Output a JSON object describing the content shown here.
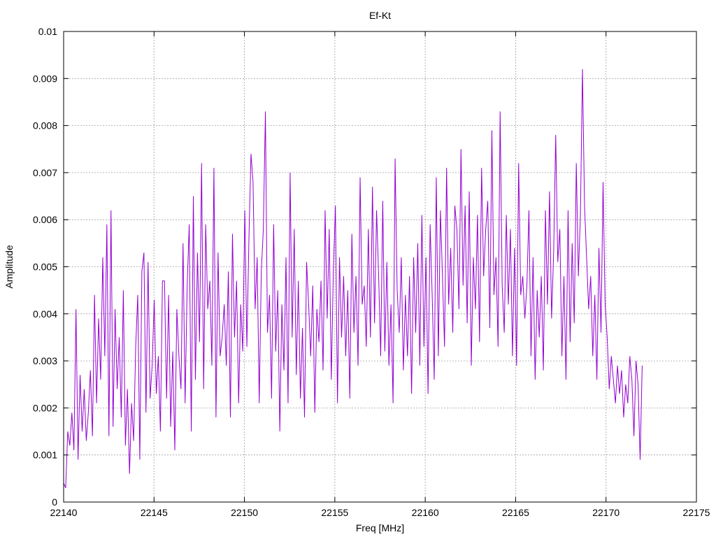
{
  "chart_data": {
    "type": "line",
    "title": "Ef-Kt",
    "xlabel": "Freq [MHz]",
    "ylabel": "Amplitude",
    "xlim": [
      22140,
      22175
    ],
    "ylim": [
      0,
      0.01
    ],
    "x_ticks": [
      "22140",
      "22145",
      "22150",
      "22155",
      "22160",
      "22165",
      "22170",
      "22175"
    ],
    "y_ticks": [
      "0",
      "0.001",
      "0.002",
      "0.003",
      "0.004",
      "0.005",
      "0.006",
      "0.007",
      "0.008",
      "0.009",
      "0.01"
    ],
    "grid": true,
    "series_color": "#9400d3",
    "x_start": 22140,
    "x_end": 22172,
    "series": [
      {
        "values": [
          0.0004,
          0.0003,
          0.0015,
          0.0012,
          0.0019,
          0.0011,
          0.0041,
          0.0009,
          0.0027,
          0.0015,
          0.0024,
          0.0013,
          0.0019,
          0.0028,
          0.0014,
          0.0044,
          0.0021,
          0.0039,
          0.0026,
          0.0052,
          0.0031,
          0.0059,
          0.0014,
          0.0062,
          0.0016,
          0.0041,
          0.0024,
          0.0035,
          0.0018,
          0.0045,
          0.0012,
          0.0024,
          0.0006,
          0.0021,
          0.0013,
          0.0033,
          0.0044,
          0.0009,
          0.0049,
          0.0053,
          0.0019,
          0.0051,
          0.0022,
          0.0029,
          0.0043,
          0.0023,
          0.0031,
          0.0015,
          0.0047,
          0.0047,
          0.0022,
          0.0044,
          0.0016,
          0.0032,
          0.0011,
          0.0041,
          0.0031,
          0.0024,
          0.0055,
          0.0021,
          0.0046,
          0.0059,
          0.0015,
          0.0065,
          0.0026,
          0.0053,
          0.0034,
          0.0072,
          0.0024,
          0.0059,
          0.0041,
          0.0047,
          0.0029,
          0.0071,
          0.0018,
          0.0053,
          0.0031,
          0.0035,
          0.0042,
          0.0029,
          0.0049,
          0.0018,
          0.0057,
          0.0035,
          0.0047,
          0.0021,
          0.0042,
          0.0032,
          0.0062,
          0.0033,
          0.0056,
          0.0074,
          0.0068,
          0.0041,
          0.0052,
          0.0021,
          0.0049,
          0.0058,
          0.0083,
          0.0036,
          0.0044,
          0.0022,
          0.0059,
          0.0032,
          0.0045,
          0.0015,
          0.0042,
          0.0028,
          0.0052,
          0.0021,
          0.007,
          0.0035,
          0.0058,
          0.0027,
          0.0047,
          0.0022,
          0.0037,
          0.0018,
          0.0051,
          0.0042,
          0.0031,
          0.0046,
          0.0019,
          0.0041,
          0.0034,
          0.0047,
          0.0028,
          0.0062,
          0.0039,
          0.0058,
          0.0026,
          0.0049,
          0.0063,
          0.0021,
          0.0052,
          0.0035,
          0.0048,
          0.0031,
          0.0045,
          0.0022,
          0.0057,
          0.0036,
          0.0048,
          0.0029,
          0.0069,
          0.0042,
          0.0046,
          0.0033,
          0.0058,
          0.0035,
          0.0067,
          0.0038,
          0.0062,
          0.0048,
          0.0031,
          0.0064,
          0.0032,
          0.0051,
          0.0029,
          0.0042,
          0.0021,
          0.0073,
          0.0045,
          0.0036,
          0.0052,
          0.0028,
          0.0044,
          0.0031,
          0.0048,
          0.0023,
          0.0052,
          0.0036,
          0.0055,
          0.0029,
          0.0061,
          0.0033,
          0.0052,
          0.0023,
          0.0059,
          0.0044,
          0.0026,
          0.0069,
          0.0031,
          0.0062,
          0.0048,
          0.0033,
          0.0071,
          0.0042,
          0.0054,
          0.0036,
          0.0063,
          0.0058,
          0.0041,
          0.0075,
          0.0046,
          0.0063,
          0.0038,
          0.0066,
          0.0029,
          0.0052,
          0.0041,
          0.0061,
          0.0034,
          0.0071,
          0.0048,
          0.0058,
          0.0064,
          0.0037,
          0.0079,
          0.0044,
          0.0052,
          0.0033,
          0.0083,
          0.0046,
          0.0036,
          0.0061,
          0.0042,
          0.0058,
          0.0031,
          0.0054,
          0.0029,
          0.0072,
          0.0044,
          0.0048,
          0.0039,
          0.0046,
          0.0062,
          0.0031,
          0.0052,
          0.0026,
          0.0045,
          0.0035,
          0.0048,
          0.0028,
          0.0062,
          0.0042,
          0.0066,
          0.0039,
          0.0053,
          0.0078,
          0.0051,
          0.0058,
          0.0031,
          0.0048,
          0.0026,
          0.0062,
          0.0034,
          0.0055,
          0.0038,
          0.0072,
          0.0048,
          0.0061,
          0.0092,
          0.0063,
          0.0052,
          0.0041,
          0.0048,
          0.0031,
          0.0044,
          0.0026,
          0.0054,
          0.0036,
          0.0068,
          0.0042,
          0.0035,
          0.0024,
          0.0031,
          0.0026,
          0.0021,
          0.0029,
          0.0023,
          0.0028,
          0.0018,
          0.0025,
          0.0021,
          0.0031,
          0.0026,
          0.0014,
          0.003,
          0.0025,
          0.0009,
          0.0029
        ]
      }
    ]
  }
}
